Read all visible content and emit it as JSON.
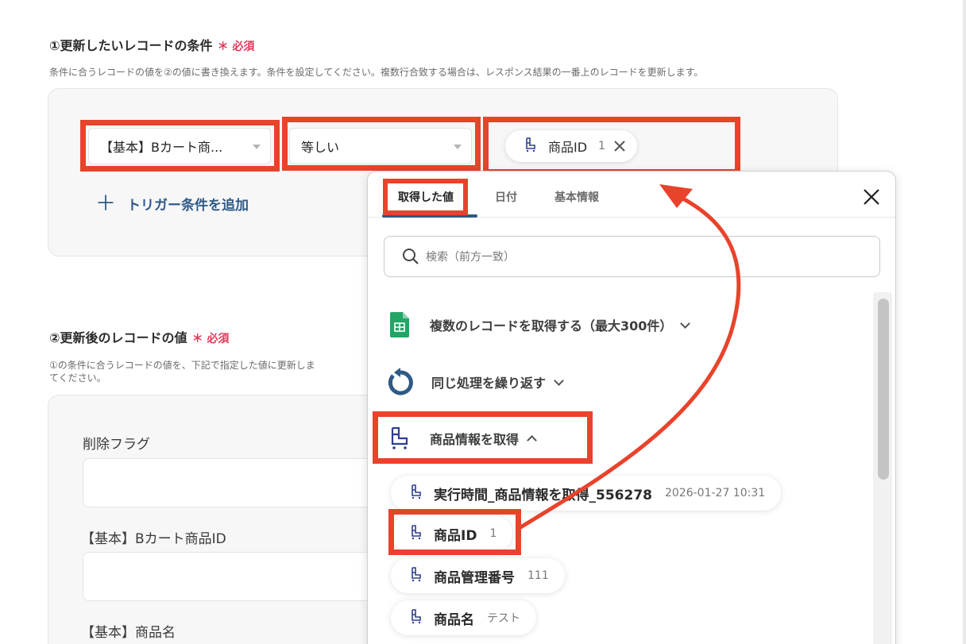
{
  "section1": {
    "title": "①更新したいレコードの条件",
    "required": "必須",
    "description": "条件に合うレコードの値を②の値に書き換えます。条件を設定してください。複数行合致する場合は、レスポンス結果の一番上のレコードを更新します。"
  },
  "condition": {
    "field_select": "【基本】Bカート商...",
    "operator_select": "等しい",
    "value_chip": {
      "label": "商品ID",
      "value": "1"
    },
    "add_condition": "トリガー条件を追加"
  },
  "section2": {
    "title": "②更新後のレコードの値",
    "required": "必須",
    "description_line1": "①の条件に合うレコードの値を、下記で指定した値に更新しま",
    "description_line2": "てください。"
  },
  "fields": [
    {
      "label": "削除フラグ"
    },
    {
      "label": "【基本】Bカート商品ID"
    },
    {
      "label": "【基本】商品名"
    }
  ],
  "popup": {
    "tabs": [
      {
        "label": "取得した値"
      },
      {
        "label": "日付"
      },
      {
        "label": "基本情報"
      }
    ],
    "search_placeholder": "検索（前方一致）",
    "groups": [
      {
        "label": "複数のレコードを取得する（最大300件）",
        "icon": "google-sheets-icon"
      },
      {
        "label": "同じ処理を繰り返す",
        "icon": "loop-icon"
      },
      {
        "label": "商品情報を取得",
        "icon": "bcart-icon"
      }
    ],
    "items": [
      {
        "label": "実行時間_商品情報を取得_556278",
        "value": "2026-01-27 10:31"
      },
      {
        "label": "商品ID",
        "value": "1"
      },
      {
        "label": "商品管理番号",
        "value": "111"
      },
      {
        "label": "商品名",
        "value": "テスト"
      }
    ]
  },
  "colors": {
    "highlight": "#e8432b",
    "accent": "#2f5a86",
    "required": "#e0395a"
  }
}
